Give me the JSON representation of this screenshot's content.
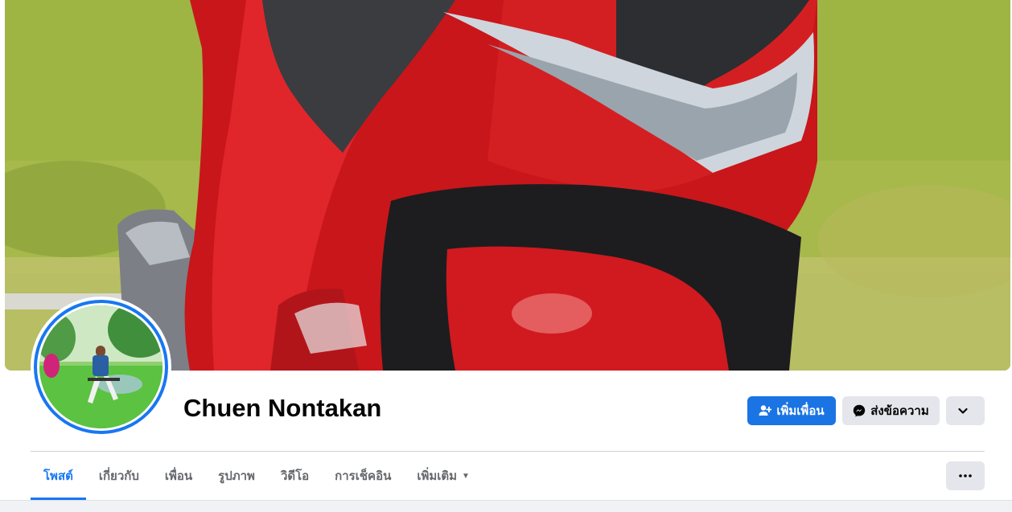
{
  "profile": {
    "name": "Chuen Nontakan",
    "cover_alt": "red-scooter-cover-photo",
    "avatar_alt": "profile-photo"
  },
  "actions": {
    "add_friend_label": "เพิ่มเพื่อน",
    "message_label": "ส่งข้อความ",
    "more_icon": "chevron-down-icon"
  },
  "tabs": [
    {
      "label": "โพสต์",
      "active": true
    },
    {
      "label": "เกี่ยวกับ",
      "active": false
    },
    {
      "label": "เพื่อน",
      "active": false
    },
    {
      "label": "รูปภาพ",
      "active": false
    },
    {
      "label": "วิดีโอ",
      "active": false
    },
    {
      "label": "การเช็คอิน",
      "active": false
    },
    {
      "label": "เพิ่มเติม",
      "active": false
    }
  ],
  "colors": {
    "accent": "#1877f2",
    "button_secondary": "#e4e6eb",
    "text_secondary": "#65676b"
  }
}
